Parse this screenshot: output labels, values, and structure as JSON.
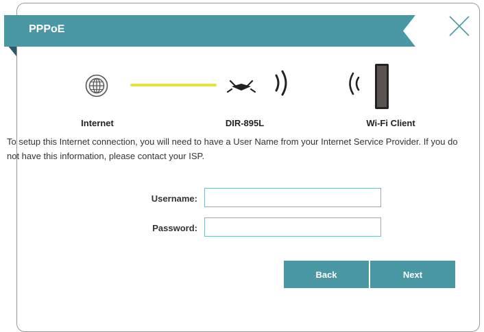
{
  "dialog": {
    "title": "PPPoE",
    "close_icon": "close-icon"
  },
  "diagram": {
    "nodes": [
      {
        "label": "Internet",
        "icon": "globe-icon"
      },
      {
        "label": "DIR-895L",
        "icon": "router-icon"
      },
      {
        "label": "Wi-Fi Client",
        "icon": "tablet-icon"
      }
    ],
    "link_color": "#e9e236",
    "accent": "#4a98a4"
  },
  "description": "To setup this Internet connection, you will need to have a User Name from your Internet Service Provider. If you do not have this information, please contact your ISP.",
  "form": {
    "username_label": "Username:",
    "username_value": "",
    "password_label": "Password:",
    "password_value": ""
  },
  "buttons": {
    "back_label": "Back",
    "next_label": "Next"
  }
}
